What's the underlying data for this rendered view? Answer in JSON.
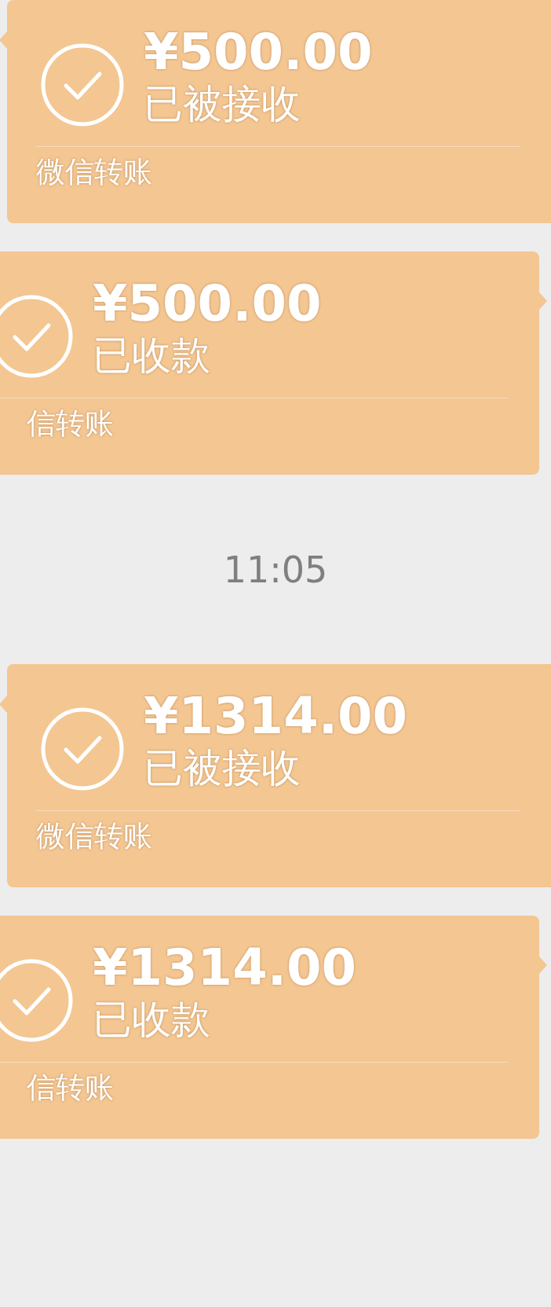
{
  "messages": [
    {
      "kind": "transfer_in",
      "amount": "¥500.00",
      "status": "已被接收",
      "label": "微信转账"
    },
    {
      "kind": "transfer_out",
      "amount": "¥500.00",
      "status": "已收款",
      "label": "信转账"
    },
    {
      "kind": "time",
      "text": "11:05"
    },
    {
      "kind": "transfer_in",
      "amount": "¥1314.00",
      "status": "已被接收",
      "label": "微信转账"
    },
    {
      "kind": "transfer_out",
      "amount": "¥1314.00",
      "status": "已收款",
      "label": "信转账"
    }
  ]
}
